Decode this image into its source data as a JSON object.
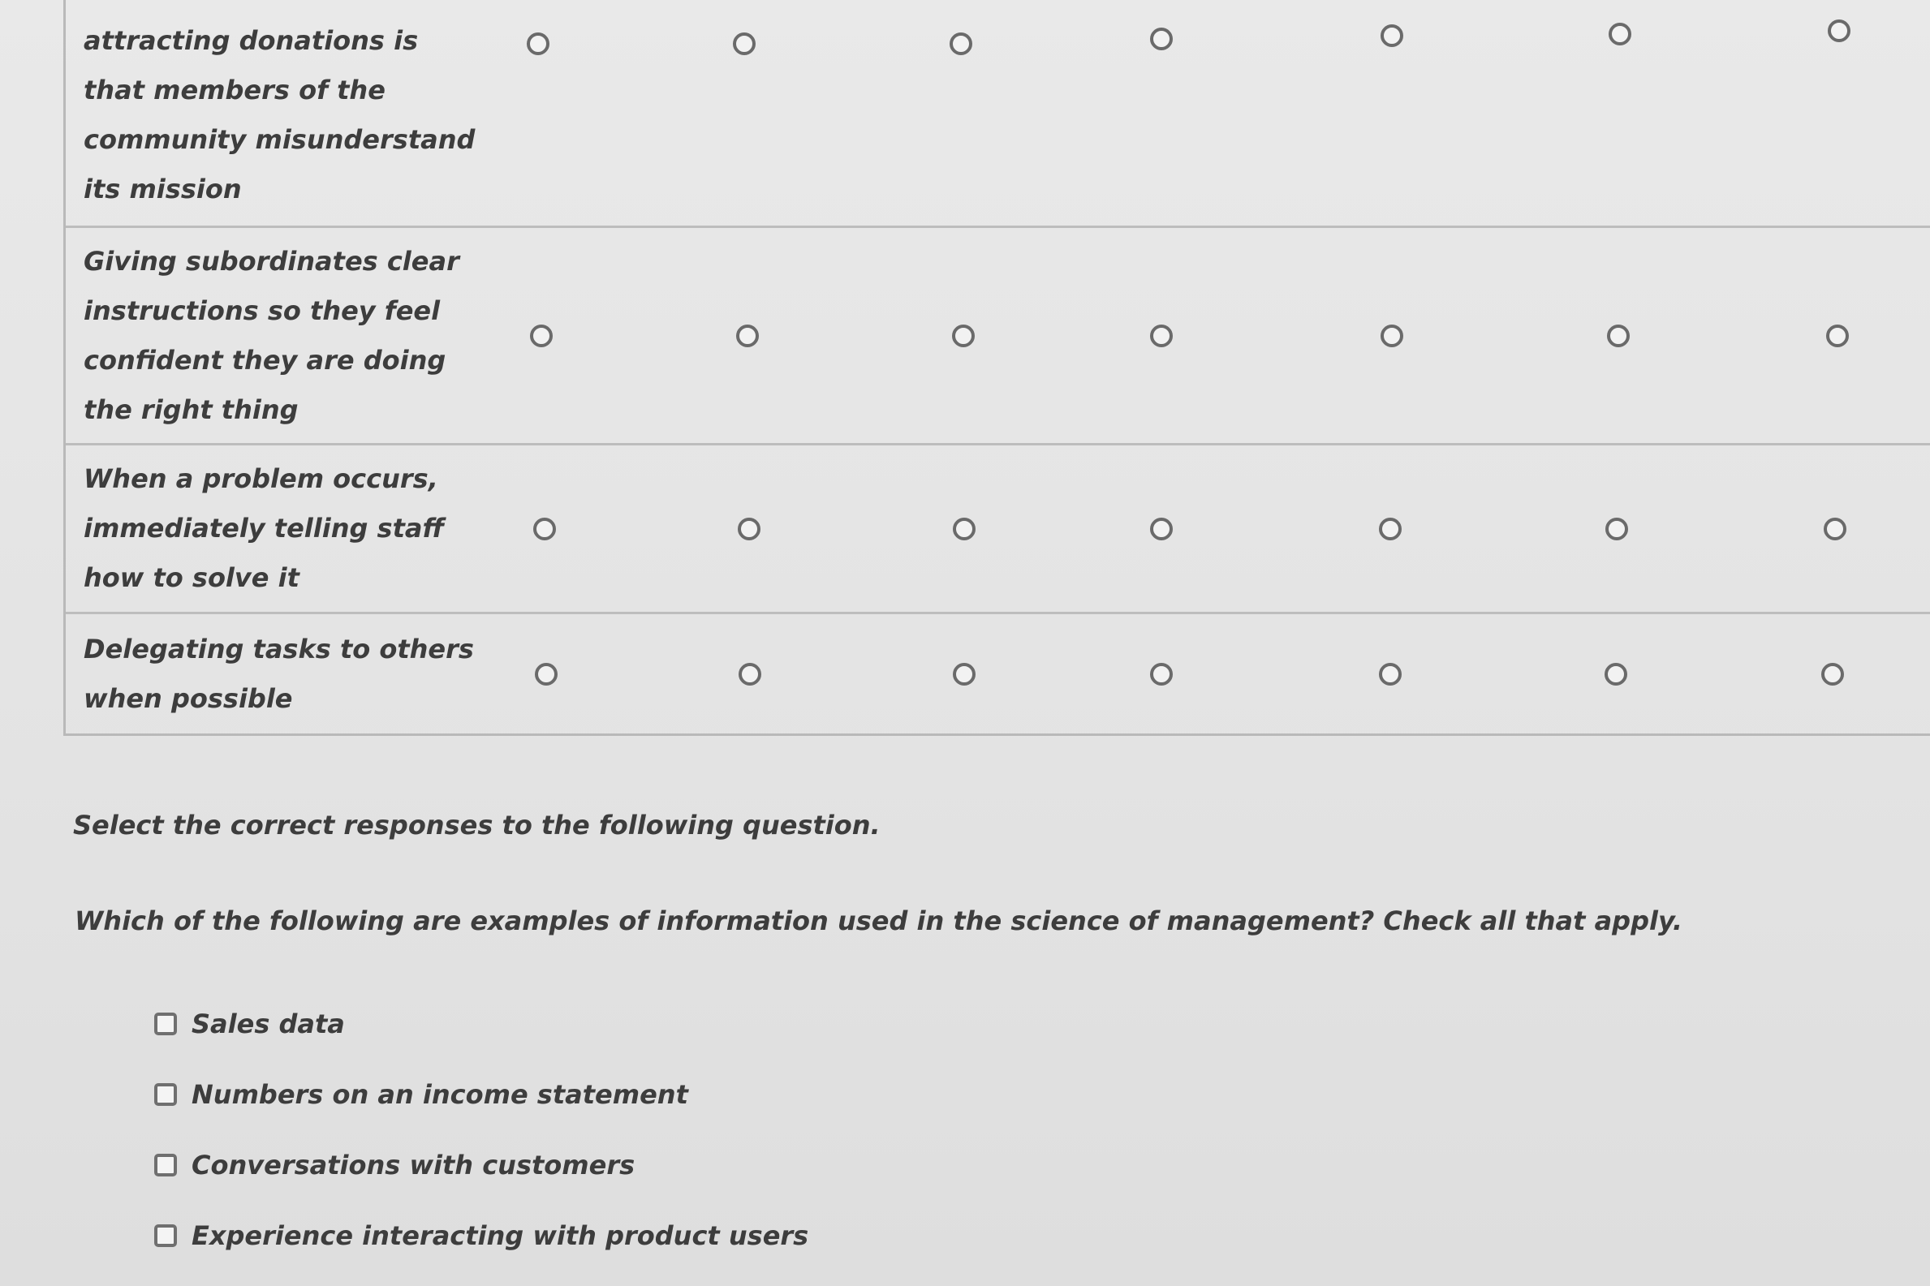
{
  "matrix": {
    "rows": [
      {
        "label": "attracting donations is\nthat members of the\ncommunity misunderstand\nits mission"
      },
      {
        "label": "Giving subordinates clear\ninstructions so they feel\nconfident they are doing\nthe right thing"
      },
      {
        "label": "When a problem occurs,\nimmediately telling staff\nhow to solve it"
      },
      {
        "label": "Delegating tasks to others\nwhen possible"
      }
    ],
    "options_per_row": 7
  },
  "question": {
    "instruction": "Select the correct responses to the following question.",
    "prompt": "Which of the following are examples of information used in the science of management? Check all that apply.",
    "choices": [
      {
        "label": "Sales data"
      },
      {
        "label": "Numbers on an income statement"
      },
      {
        "label": "Conversations with customers"
      },
      {
        "label": "Experience interacting with product users"
      }
    ]
  }
}
